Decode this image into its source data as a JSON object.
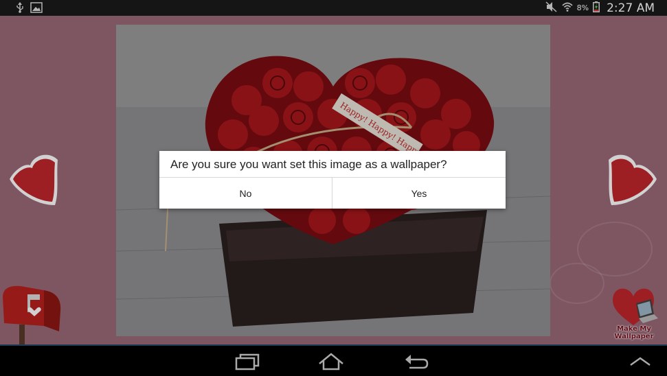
{
  "status_bar": {
    "left_icons": [
      "usb-icon",
      "image-icon"
    ],
    "right_icons": [
      "muted-icon",
      "wifi-icon",
      "battery-icon"
    ],
    "battery_percent": "8%",
    "time": "2:27 AM"
  },
  "app": {
    "photo": {
      "ribbon_text": "Happy! Happy! Happy!",
      "heart_color": "#a8171c"
    },
    "nav": {
      "prev_icon": "heart-left-arrow-icon",
      "next_icon": "heart-right-arrow-icon"
    },
    "mailbox_icon": "mailbox-icon",
    "make_wallpaper": {
      "icon": "heart-laptop-icon",
      "label_line1": "Make My",
      "label_line2": "Wallpaper"
    }
  },
  "dialog": {
    "message": "Are you sure you want set this image as a wallpaper?",
    "no_label": "No",
    "yes_label": "Yes"
  },
  "nav_bar": {
    "recent_icon": "recent-apps-icon",
    "home_icon": "home-icon",
    "back_icon": "back-icon",
    "menu_icon": "menu-up-icon"
  },
  "colors": {
    "app_background": "#9a6a77",
    "accent_red": "#c0262b",
    "nav_bar_border": "#1c3a55"
  }
}
